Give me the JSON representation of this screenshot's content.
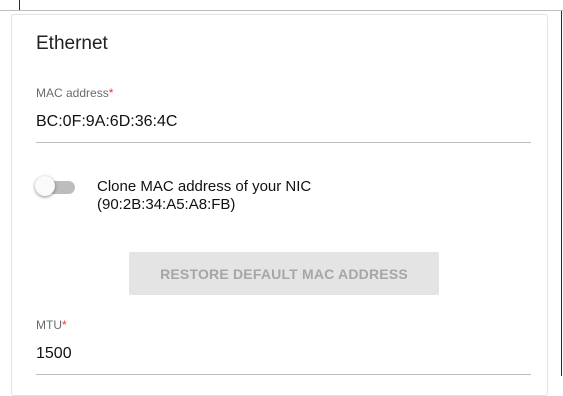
{
  "ethernet": {
    "title": "Ethernet",
    "mac": {
      "label": "MAC address",
      "required_mark": "*",
      "value": "BC:0F:9A:6D:36:4C"
    },
    "clone": {
      "label": "Clone MAC address of your NIC",
      "nic_mac": "(90:2B:34:A5:A8:FB)",
      "enabled": false
    },
    "restore_button": "RESTORE DEFAULT MAC ADDRESS",
    "mtu": {
      "label": "MTU",
      "required_mark": "*",
      "value": "1500"
    }
  },
  "colors": {
    "required": "#e53935",
    "toggle_track": "#bdbdbd",
    "button_disabled_bg": "#e4e4e4",
    "button_disabled_text": "#a6a6a6"
  }
}
